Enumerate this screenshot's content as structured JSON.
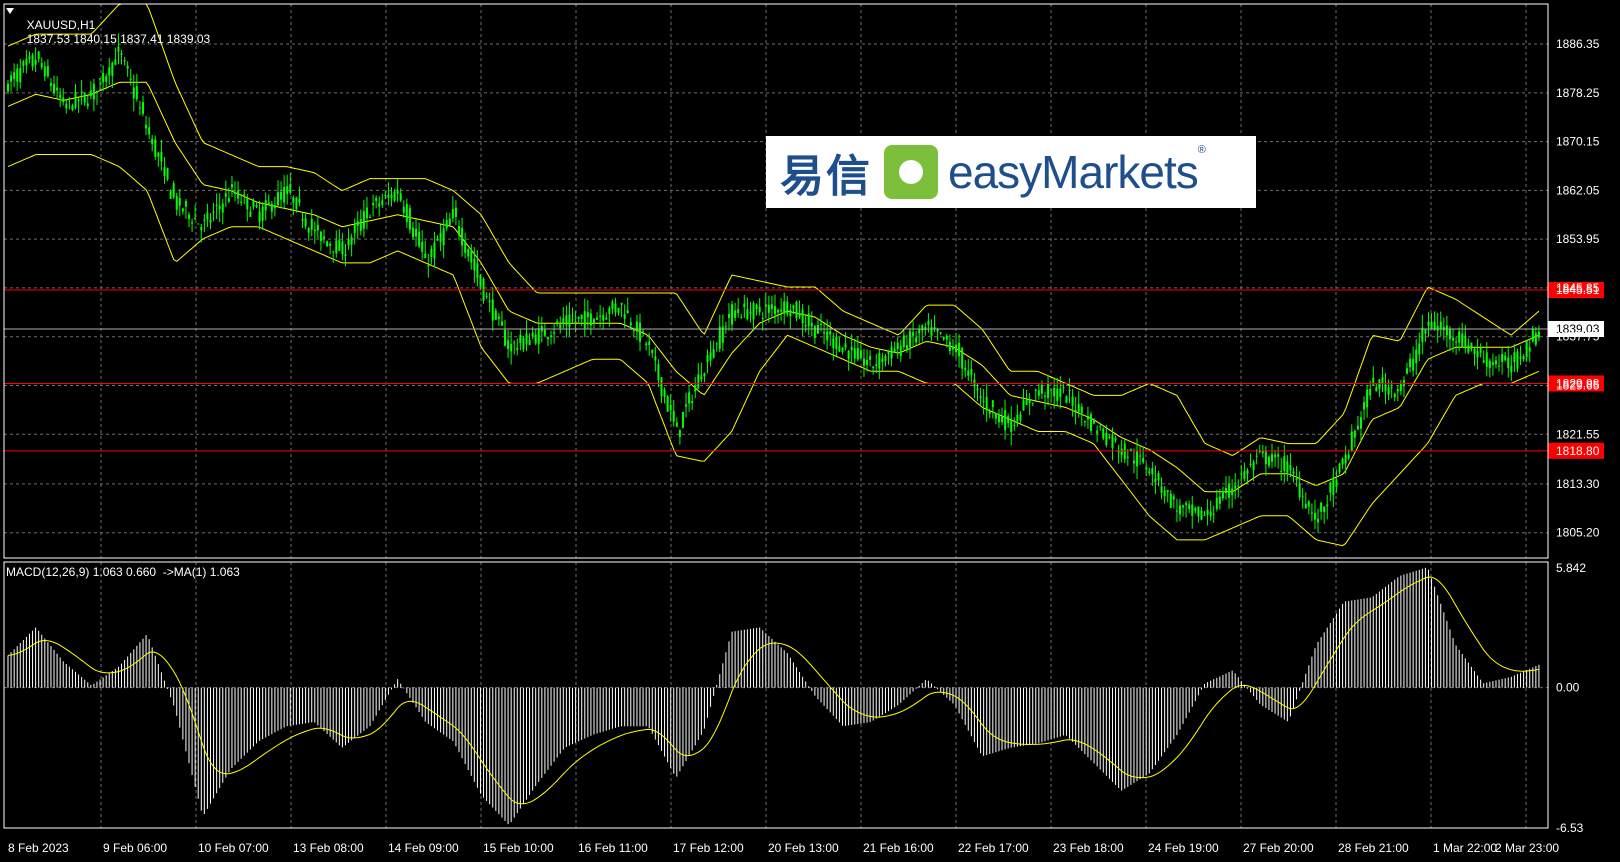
{
  "header": {
    "symbol": "XAUUSD,H1",
    "ohlc": "1837.53 1840.15 1837.41 1839.03"
  },
  "macd_header": "MACD(12,26,9) 1.063 0.660  ->MA(1) 1.063",
  "logo": {
    "cn": "易信",
    "en": "easyMarkets",
    "reg": "®"
  },
  "colors": {
    "background": "#000000",
    "candles": "#00ff00",
    "bollinger": "#ffff00",
    "levels": "#ff0000",
    "grid": "#6e6e6e",
    "macd_hist": "#ffffff",
    "macd_signal": "#ffff00"
  },
  "chart_data": [
    {
      "type": "line",
      "title": "XAUUSD,H1",
      "ylim": [
        1801.0,
        1893.0
      ],
      "y_ticks": [
        "1886.35",
        "1878.25",
        "1870.15",
        "1862.05",
        "1853.95",
        "1845.85",
        "1837.75",
        "1829.65",
        "1821.55",
        "1813.30",
        "1805.20"
      ],
      "x_ticks": [
        "8 Feb 2023",
        "9 Feb 06:00",
        "10 Feb 07:00",
        "13 Feb 08:00",
        "14 Feb 09:00",
        "15 Feb 10:00",
        "16 Feb 11:00",
        "17 Feb 12:00",
        "20 Feb 13:00",
        "21 Feb 16:00",
        "22 Feb 17:00",
        "23 Feb 18:00",
        "24 Feb 19:00",
        "27 Feb 20:00",
        "28 Feb 21:00",
        "1 Mar 22:00",
        "2 Mar 23:00"
      ],
      "price_series": [
        {
          "name": "close",
          "values": [
            1880,
            1884,
            1876,
            1878,
            1885,
            1872,
            1860,
            1856,
            1862,
            1858,
            1862,
            1855,
            1852,
            1859,
            1862,
            1850,
            1858,
            1846,
            1836,
            1838,
            1840,
            1841,
            1843,
            1836,
            1822,
            1833,
            1842,
            1842,
            1843,
            1839,
            1836,
            1833,
            1836,
            1839,
            1836,
            1827,
            1823,
            1829,
            1828,
            1823,
            1819,
            1816,
            1809,
            1808,
            1813,
            1818,
            1816,
            1807,
            1817,
            1830,
            1829,
            1840,
            1838,
            1834,
            1833,
            1839
          ]
        },
        {
          "name": "upper band",
          "values": [
            1886,
            1888,
            1888,
            1888,
            1893,
            1893,
            1880,
            1870,
            1868,
            1866,
            1866,
            1865,
            1862,
            1864,
            1864,
            1864,
            1862,
            1858,
            1850,
            1845,
            1845,
            1845,
            1845,
            1845,
            1845,
            1838,
            1848,
            1847,
            1846,
            1846,
            1842,
            1840,
            1838,
            1843,
            1843,
            1839,
            1832,
            1832,
            1830,
            1828,
            1828,
            1830,
            1828,
            1820,
            1818,
            1821,
            1820,
            1820,
            1825,
            1838,
            1837,
            1846,
            1844,
            1841,
            1838,
            1842
          ]
        },
        {
          "name": "middle band",
          "values": [
            1876,
            1878,
            1877,
            1878,
            1880,
            1880,
            1870,
            1863,
            1862,
            1860,
            1859,
            1858,
            1856,
            1857,
            1858,
            1857,
            1856,
            1850,
            1842,
            1840,
            1840,
            1840,
            1840,
            1838,
            1832,
            1828,
            1835,
            1840,
            1842,
            1841,
            1838,
            1836,
            1835,
            1837,
            1836,
            1833,
            1828,
            1827,
            1826,
            1824,
            1821,
            1819,
            1816,
            1812,
            1812,
            1815,
            1815,
            1813,
            1815,
            1824,
            1826,
            1834,
            1836,
            1836,
            1836,
            1838
          ]
        },
        {
          "name": "lower band",
          "values": [
            1866,
            1868,
            1868,
            1868,
            1866,
            1862,
            1850,
            1854,
            1856,
            1856,
            1854,
            1852,
            1850,
            1850,
            1852,
            1850,
            1848,
            1836,
            1830,
            1830,
            1832,
            1834,
            1834,
            1830,
            1818,
            1817,
            1822,
            1832,
            1838,
            1836,
            1834,
            1832,
            1832,
            1830,
            1830,
            1826,
            1824,
            1822,
            1822,
            1820,
            1814,
            1808,
            1804,
            1804,
            1806,
            1808,
            1808,
            1804,
            1803,
            1810,
            1815,
            1820,
            1828,
            1830,
            1830,
            1832
          ]
        }
      ],
      "levels": [
        {
          "price": 1845.51,
          "label": "1845.51"
        },
        {
          "price": 1829.98,
          "label": "1829.98"
        },
        {
          "price": 1818.8,
          "label": "1818.80"
        }
      ],
      "current_price": {
        "price": 1839.03,
        "label": "1839.03"
      },
      "grid": true
    },
    {
      "type": "bar",
      "title": "MACD(12,26,9)",
      "ylim": [
        -6.53,
        5.842
      ],
      "y_ticks": [
        "5.842",
        "0.00",
        "-6.53"
      ],
      "series": [
        {
          "name": "MACD",
          "values": [
            1.5,
            2.8,
            1.2,
            0.1,
            1.0,
            2.5,
            -1.0,
            -6.0,
            -3.8,
            -2.5,
            -1.8,
            -1.6,
            -2.8,
            -1.8,
            0.4,
            -1.6,
            -2.5,
            -5.0,
            -6.4,
            -4.5,
            -2.8,
            -2.2,
            -1.8,
            -1.8,
            -4.2,
            -2.0,
            2.6,
            2.8,
            1.6,
            -0.4,
            -1.8,
            -1.6,
            -0.8,
            0.4,
            -0.8,
            -3.2,
            -2.8,
            -2.6,
            -2.2,
            -3.5,
            -4.8,
            -4.0,
            -2.2,
            0.2,
            0.8,
            -0.8,
            -1.6,
            2.0,
            4.0,
            4.2,
            5.2,
            5.6,
            2.0,
            0.2,
            0.5,
            1.063
          ]
        }
      ]
    }
  ]
}
